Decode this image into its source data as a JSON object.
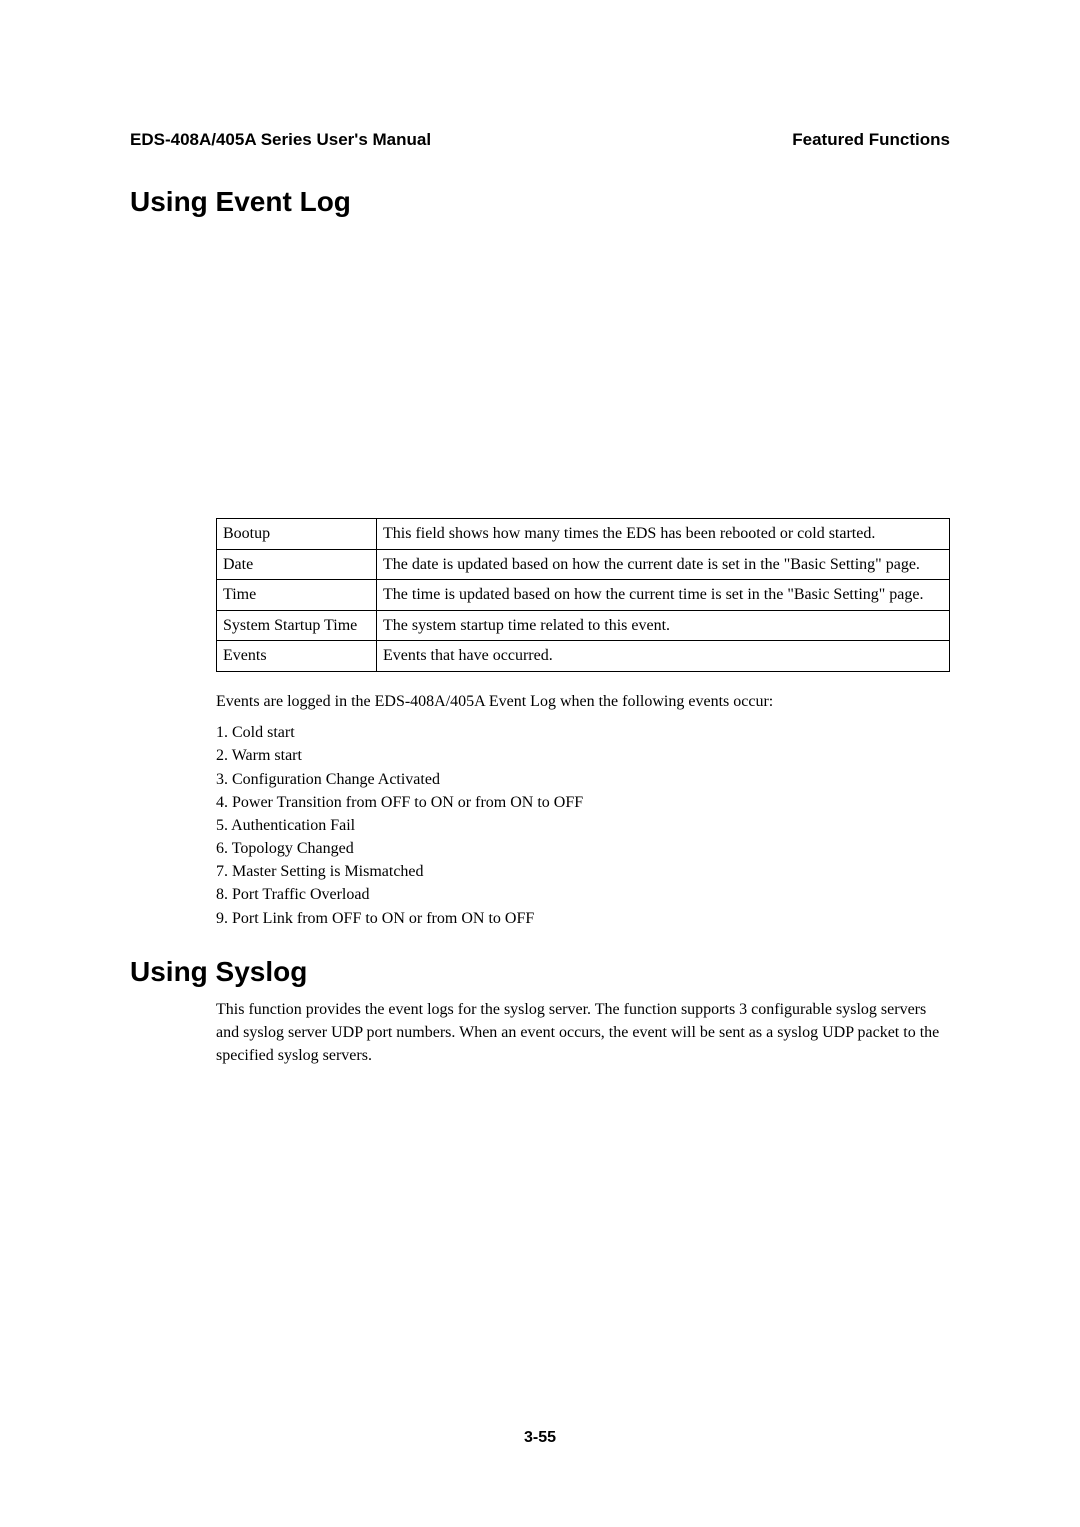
{
  "header": {
    "left": "EDS-408A/405A Series User's Manual",
    "right": "Featured Functions"
  },
  "section1": {
    "title": "Using Event Log"
  },
  "table": {
    "r0": {
      "k": "Bootup",
      "v": "This field shows how many times the EDS has been rebooted or cold started."
    },
    "r1": {
      "k": "Date",
      "v": "The date is updated based on how the current date is set in the \"Basic Setting\" page."
    },
    "r2": {
      "k": "Time",
      "v": "The time is updated based on how the current time is set in the \"Basic Setting\" page."
    },
    "r3": {
      "k": "System Startup Time",
      "v": "The system startup time related to this event."
    },
    "r4": {
      "k": "Events",
      "v": "Events that have occurred."
    }
  },
  "eventsIntro": "Events are logged in the EDS-408A/405A Event Log when the following events occur:",
  "events": {
    "e1": "1.  Cold start",
    "e2": "2.  Warm start",
    "e3": "3.  Configuration Change Activated",
    "e4": "4.  Power Transition from OFF to ON or from ON to OFF",
    "e5": "5.  Authentication Fail",
    "e6": "6.  Topology Changed",
    "e7": "7.  Master Setting is Mismatched",
    "e8": "8.  Port Traffic Overload",
    "e9": "9.  Port Link from OFF to ON or from ON to OFF"
  },
  "section2": {
    "title": "Using Syslog",
    "body": "This function provides the event logs for the syslog server. The function supports 3 configurable syslog servers and syslog server UDP port numbers. When an event occurs, the event will be sent as a syslog UDP packet to the specified syslog servers."
  },
  "pageNumber": "3-55"
}
